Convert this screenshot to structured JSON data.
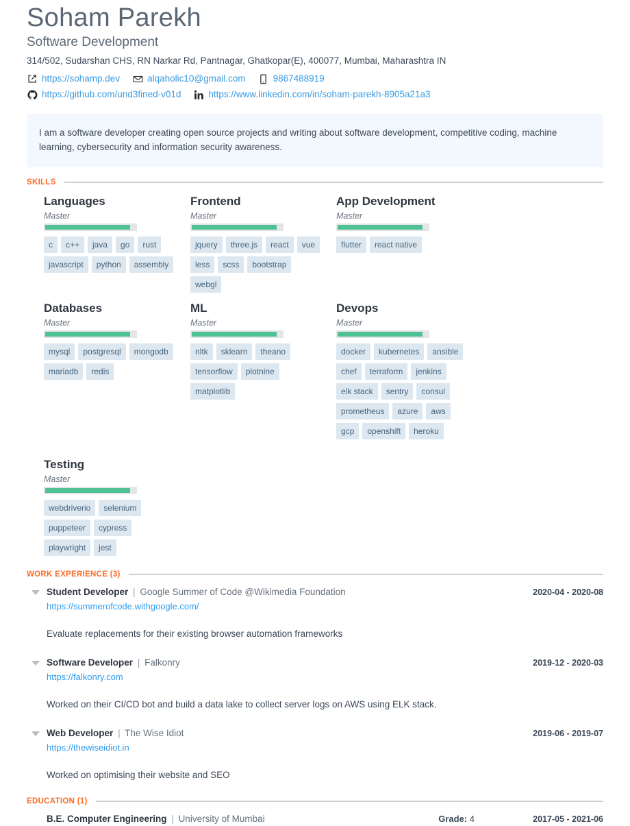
{
  "header": {
    "name": "Soham Parekh",
    "subtitle": "Software Development",
    "address": "314/502, Sudarshan CHS, RN Narkar Rd, Pantnagar, Ghatkopar(E), 400077, Mumbai, Maharashtra IN",
    "contacts_row1": [
      {
        "icon": "external-link-icon",
        "text": "https://sohamp.dev"
      },
      {
        "icon": "envelope-icon",
        "text": "alqaholic10@gmail.com"
      },
      {
        "icon": "mobile-phone-icon",
        "text": "9867488919"
      }
    ],
    "contacts_row2": [
      {
        "icon": "github-icon",
        "text": "https://github.com/und3fined-v01d"
      },
      {
        "icon": "linkedin-icon",
        "text": "https://www.linkedin.com/in/soham-parekh-8905a21a3"
      }
    ]
  },
  "summary": {
    "text": "I am a software developer creating open source projects and writing about software development, competitive coding, machine learning, cybersecurity and information security awareness."
  },
  "sections": {
    "skills_label": "SKILLS",
    "work_label": "WORK EXPERIENCE (3)",
    "education_label": "EDUCATION (1)"
  },
  "skills": [
    {
      "title": "Languages",
      "level": "Master",
      "level_percent": 94,
      "tags": [
        "c",
        "c++",
        "java",
        "go",
        "rust",
        "javascript",
        "python",
        "assembly"
      ]
    },
    {
      "title": "Frontend",
      "level": "Master",
      "level_percent": 94,
      "tags": [
        "jquery",
        "three.js",
        "react",
        "vue",
        "less",
        "scss",
        "bootstrap",
        "webgl"
      ]
    },
    {
      "title": "App Development",
      "level": "Master",
      "level_percent": 94,
      "tags": [
        "flutter",
        "react native"
      ]
    },
    {
      "title": "Databases",
      "level": "Master",
      "level_percent": 94,
      "tags": [
        "mysql",
        "postgresql",
        "mongodb",
        "mariadb",
        "redis"
      ]
    },
    {
      "title": "ML",
      "level": "Master",
      "level_percent": 94,
      "tags": [
        "nltk",
        "sklearn",
        "theano",
        "tensorflow",
        "plotnine",
        "matplotlib"
      ]
    },
    {
      "title": "Devops",
      "level": "Master",
      "level_percent": 94,
      "tags": [
        "docker",
        "kubernetes",
        "ansible",
        "chef",
        "terraform",
        "jenkins",
        "elk stack",
        "sentry",
        "consul",
        "prometheus",
        "azure",
        "aws",
        "gcp",
        "openshift",
        "heroku"
      ]
    }
  ],
  "skills_testing": {
    "title": "Testing",
    "level": "Master",
    "level_percent": 94,
    "tags": [
      "webdriverio",
      "selenium",
      "puppeteer",
      "cypress",
      "playwright",
      "jest"
    ]
  },
  "work": [
    {
      "role": "Student Developer",
      "separator": "|",
      "org": "Google Summer of Code @Wikimedia Foundation",
      "url": "https://summerofcode.withgoogle.com/",
      "date": "2020-04 - 2020-08",
      "description": "Evaluate replacements for their existing browser automation frameworks"
    },
    {
      "role": "Software Developer",
      "separator": "|",
      "org": "Falkonry",
      "url": "https://falkonry.com",
      "date": "2019-12 - 2020-03",
      "description": "Worked on their CI/CD bot and build a data lake to collect server logs on AWS using ELK stack."
    },
    {
      "role": "Web Developer",
      "separator": "|",
      "org": "The Wise Idiot",
      "url": "https://thewiseidiot.in",
      "date": "2019-06 - 2019-07",
      "description": "Worked on optimising their website and SEO"
    }
  ],
  "education": [
    {
      "degree": "B.E. Computer Engineering",
      "separator": "|",
      "institution": "University of Mumbai",
      "grade_label": "Grade:",
      "grade_value": "4",
      "date": "2017-05 - 2021-06"
    }
  ],
  "colors": {
    "accent_orange": "#fc6a21",
    "link_blue": "#3b9ae1",
    "skill_green": "#4ec294",
    "tag_bg": "#dde7ef",
    "tag_text": "#46647e",
    "summary_bg": "#f2f8fd"
  }
}
